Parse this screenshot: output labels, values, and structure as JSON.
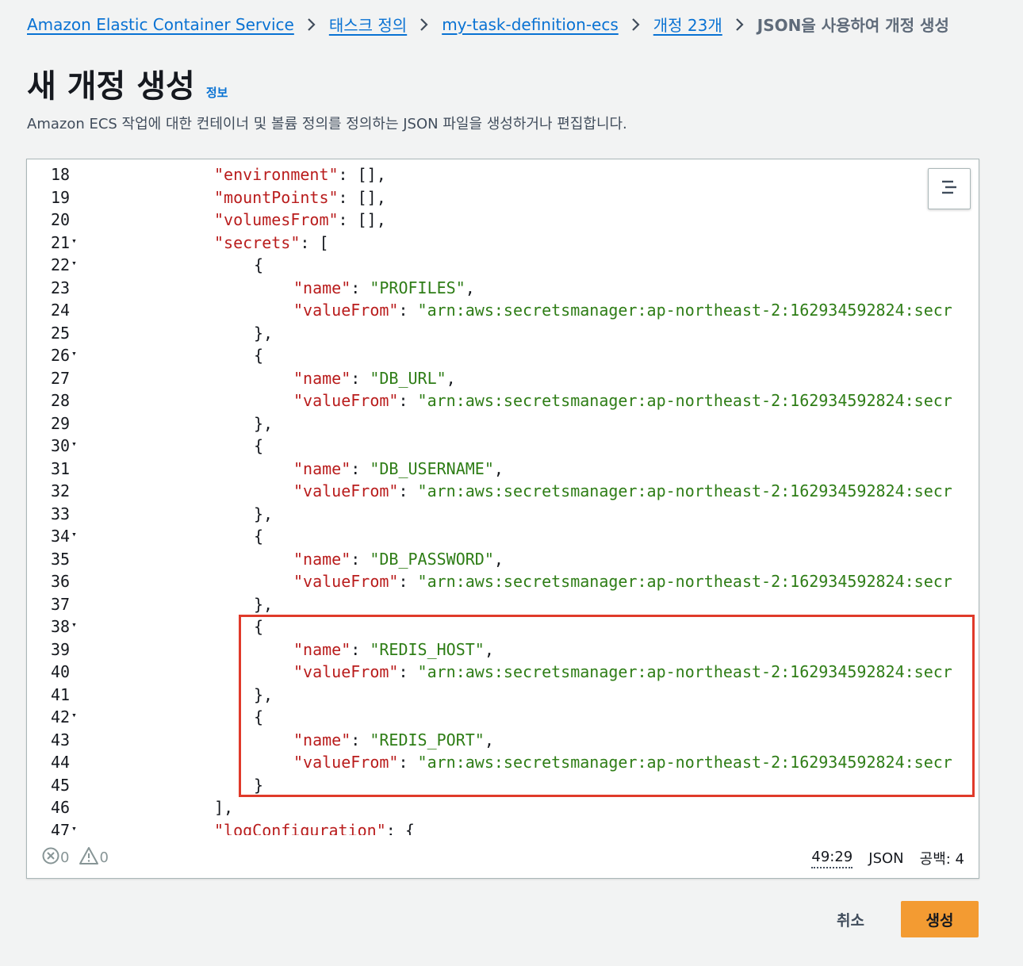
{
  "breadcrumb": {
    "items": [
      {
        "label": "Amazon Elastic Container Service"
      },
      {
        "label": "태스크 정의"
      },
      {
        "label": "my-task-definition-ecs"
      },
      {
        "label": "개정 23개"
      }
    ],
    "current": "JSON을 사용하여 개정 생성"
  },
  "header": {
    "title": "새 개정 생성",
    "info_label": "정보",
    "description": "Amazon ECS 작업에 대한 컨테이너 및 볼륨 정의를 정의하는 JSON 파일을 생성하거나 편집합니다."
  },
  "editor": {
    "lines": [
      {
        "n": "18",
        "fold": "",
        "indent": 2,
        "tokens": [
          {
            "t": "k",
            "v": "\"environment\""
          },
          {
            "t": "p",
            "v": ": [],"
          }
        ]
      },
      {
        "n": "19",
        "fold": "",
        "indent": 2,
        "tokens": [
          {
            "t": "k",
            "v": "\"mountPoints\""
          },
          {
            "t": "p",
            "v": ": [],"
          }
        ]
      },
      {
        "n": "20",
        "fold": "",
        "indent": 2,
        "tokens": [
          {
            "t": "k",
            "v": "\"volumesFrom\""
          },
          {
            "t": "p",
            "v": ": [],"
          }
        ]
      },
      {
        "n": "21",
        "fold": "▾",
        "indent": 2,
        "tokens": [
          {
            "t": "k",
            "v": "\"secrets\""
          },
          {
            "t": "p",
            "v": ": ["
          }
        ]
      },
      {
        "n": "22",
        "fold": "▾",
        "indent": 3,
        "tokens": [
          {
            "t": "p",
            "v": "{"
          }
        ]
      },
      {
        "n": "23",
        "fold": "",
        "indent": 4,
        "tokens": [
          {
            "t": "k",
            "v": "\"name\""
          },
          {
            "t": "p",
            "v": ": "
          },
          {
            "t": "s",
            "v": "\"PROFILES\""
          },
          {
            "t": "p",
            "v": ","
          }
        ]
      },
      {
        "n": "24",
        "fold": "",
        "indent": 4,
        "tokens": [
          {
            "t": "k",
            "v": "\"valueFrom\""
          },
          {
            "t": "p",
            "v": ": "
          },
          {
            "t": "s",
            "v": "\"arn:aws:secretsmanager:ap-northeast-2:162934592824:secr"
          }
        ]
      },
      {
        "n": "25",
        "fold": "",
        "indent": 3,
        "tokens": [
          {
            "t": "p",
            "v": "},"
          }
        ]
      },
      {
        "n": "26",
        "fold": "▾",
        "indent": 3,
        "tokens": [
          {
            "t": "p",
            "v": "{"
          }
        ]
      },
      {
        "n": "27",
        "fold": "",
        "indent": 4,
        "tokens": [
          {
            "t": "k",
            "v": "\"name\""
          },
          {
            "t": "p",
            "v": ": "
          },
          {
            "t": "s",
            "v": "\"DB_URL\""
          },
          {
            "t": "p",
            "v": ","
          }
        ]
      },
      {
        "n": "28",
        "fold": "",
        "indent": 4,
        "tokens": [
          {
            "t": "k",
            "v": "\"valueFrom\""
          },
          {
            "t": "p",
            "v": ": "
          },
          {
            "t": "s",
            "v": "\"arn:aws:secretsmanager:ap-northeast-2:162934592824:secr"
          }
        ]
      },
      {
        "n": "29",
        "fold": "",
        "indent": 3,
        "tokens": [
          {
            "t": "p",
            "v": "},"
          }
        ]
      },
      {
        "n": "30",
        "fold": "▾",
        "indent": 3,
        "tokens": [
          {
            "t": "p",
            "v": "{"
          }
        ]
      },
      {
        "n": "31",
        "fold": "",
        "indent": 4,
        "tokens": [
          {
            "t": "k",
            "v": "\"name\""
          },
          {
            "t": "p",
            "v": ": "
          },
          {
            "t": "s",
            "v": "\"DB_USERNAME\""
          },
          {
            "t": "p",
            "v": ","
          }
        ]
      },
      {
        "n": "32",
        "fold": "",
        "indent": 4,
        "tokens": [
          {
            "t": "k",
            "v": "\"valueFrom\""
          },
          {
            "t": "p",
            "v": ": "
          },
          {
            "t": "s",
            "v": "\"arn:aws:secretsmanager:ap-northeast-2:162934592824:secr"
          }
        ]
      },
      {
        "n": "33",
        "fold": "",
        "indent": 3,
        "tokens": [
          {
            "t": "p",
            "v": "},"
          }
        ]
      },
      {
        "n": "34",
        "fold": "▾",
        "indent": 3,
        "tokens": [
          {
            "t": "p",
            "v": "{"
          }
        ]
      },
      {
        "n": "35",
        "fold": "",
        "indent": 4,
        "tokens": [
          {
            "t": "k",
            "v": "\"name\""
          },
          {
            "t": "p",
            "v": ": "
          },
          {
            "t": "s",
            "v": "\"DB_PASSWORD\""
          },
          {
            "t": "p",
            "v": ","
          }
        ]
      },
      {
        "n": "36",
        "fold": "",
        "indent": 4,
        "tokens": [
          {
            "t": "k",
            "v": "\"valueFrom\""
          },
          {
            "t": "p",
            "v": ": "
          },
          {
            "t": "s",
            "v": "\"arn:aws:secretsmanager:ap-northeast-2:162934592824:secr"
          }
        ]
      },
      {
        "n": "37",
        "fold": "",
        "indent": 3,
        "tokens": [
          {
            "t": "p",
            "v": "},"
          }
        ]
      },
      {
        "n": "38",
        "fold": "▾",
        "indent": 3,
        "tokens": [
          {
            "t": "p",
            "v": "{"
          }
        ]
      },
      {
        "n": "39",
        "fold": "",
        "indent": 4,
        "tokens": [
          {
            "t": "k",
            "v": "\"name\""
          },
          {
            "t": "p",
            "v": ": "
          },
          {
            "t": "s",
            "v": "\"REDIS_HOST\""
          },
          {
            "t": "p",
            "v": ","
          }
        ]
      },
      {
        "n": "40",
        "fold": "",
        "indent": 4,
        "tokens": [
          {
            "t": "k",
            "v": "\"valueFrom\""
          },
          {
            "t": "p",
            "v": ": "
          },
          {
            "t": "s",
            "v": "\"arn:aws:secretsmanager:ap-northeast-2:162934592824:secr"
          }
        ]
      },
      {
        "n": "41",
        "fold": "",
        "indent": 3,
        "tokens": [
          {
            "t": "p",
            "v": "},"
          }
        ]
      },
      {
        "n": "42",
        "fold": "▾",
        "indent": 3,
        "tokens": [
          {
            "t": "p",
            "v": "{"
          }
        ]
      },
      {
        "n": "43",
        "fold": "",
        "indent": 4,
        "tokens": [
          {
            "t": "k",
            "v": "\"name\""
          },
          {
            "t": "p",
            "v": ": "
          },
          {
            "t": "s",
            "v": "\"REDIS_PORT\""
          },
          {
            "t": "p",
            "v": ","
          }
        ]
      },
      {
        "n": "44",
        "fold": "",
        "indent": 4,
        "tokens": [
          {
            "t": "k",
            "v": "\"valueFrom\""
          },
          {
            "t": "p",
            "v": ": "
          },
          {
            "t": "s",
            "v": "\"arn:aws:secretsmanager:ap-northeast-2:162934592824:secr"
          }
        ]
      },
      {
        "n": "45",
        "fold": "",
        "indent": 3,
        "tokens": [
          {
            "t": "p",
            "v": "}"
          }
        ]
      },
      {
        "n": "46",
        "fold": "",
        "indent": 2,
        "tokens": [
          {
            "t": "p",
            "v": "],"
          }
        ]
      },
      {
        "n": "47",
        "fold": "▾",
        "indent": 2,
        "tokens": [
          {
            "t": "k",
            "v": "\"logConfiguration\""
          },
          {
            "t": "p",
            "v": ": {"
          }
        ]
      }
    ],
    "status": {
      "errors": "0",
      "warnings": "0",
      "cursor": "49:29",
      "language": "JSON",
      "spaces": "공백: 4"
    }
  },
  "colors": {
    "link": "#0972d3",
    "json_key": "#b91c1c",
    "json_string": "#2e7d16",
    "highlight": "#e03a2a",
    "primary_button": "#f39b32"
  },
  "icons": [
    "chevron-right-icon",
    "minimap-icon",
    "error-icon",
    "warning-icon"
  ],
  "actions": {
    "cancel_label": "취소",
    "create_label": "생성"
  }
}
